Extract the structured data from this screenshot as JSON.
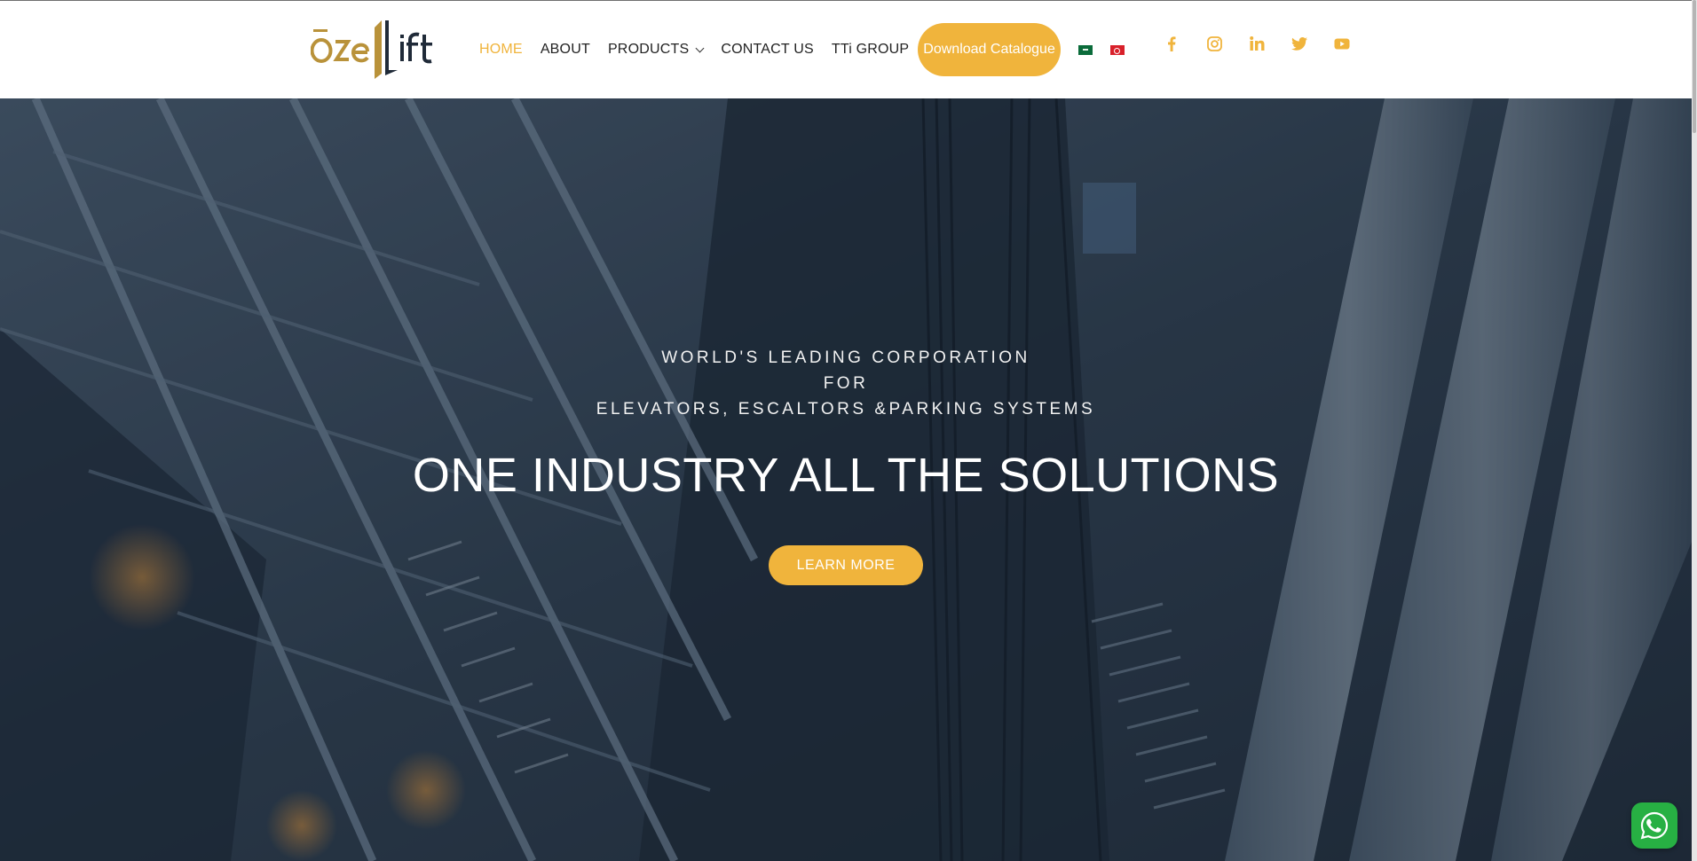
{
  "header": {
    "logo_text": "Özelift",
    "nav": {
      "home": "HOME",
      "about": "ABOUT",
      "products": "PRODUCTS",
      "contact": "CONTACT US",
      "group": "TTi GROUP",
      "download": "Download Catalogue"
    },
    "languages": [
      "Arabic",
      "Turkish"
    ],
    "social_icons": [
      "facebook-icon",
      "instagram-icon",
      "linkedin-icon",
      "twitter-icon",
      "youtube-icon"
    ]
  },
  "hero": {
    "subtitle_line1": "WORLD'S LEADING CORPORATION",
    "subtitle_line2": "FOR",
    "subtitle_line3": "ELEVATORS, ESCALTORS &PARKING SYSTEMS",
    "headline": "ONE INDUSTRY ALL THE SOLUTIONS",
    "cta": "LEARN MORE"
  },
  "colors": {
    "accent": "#f0b43c",
    "nav_text": "#222222",
    "logo_dark": "#1f2a38",
    "hero_overlay": "#1a2838",
    "whatsapp": "#27b043"
  }
}
